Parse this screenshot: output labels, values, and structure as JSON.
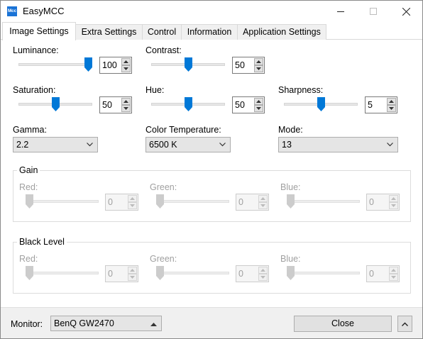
{
  "window": {
    "app_icon_text": "Mcc",
    "title": "EasyMCC"
  },
  "tabs": [
    {
      "label": "Image Settings",
      "active": true
    },
    {
      "label": "Extra Settings",
      "active": false
    },
    {
      "label": "Control",
      "active": false
    },
    {
      "label": "Information",
      "active": false
    },
    {
      "label": "Application Settings",
      "active": false
    }
  ],
  "image_settings": {
    "luminance": {
      "label": "Luminance:",
      "value": "100",
      "level_percent": 100
    },
    "contrast": {
      "label": "Contrast:",
      "value": "50",
      "level_percent": 50
    },
    "saturation": {
      "label": "Saturation:",
      "value": "50",
      "level_percent": 50
    },
    "hue": {
      "label": "Hue:",
      "value": "50",
      "level_percent": 50
    },
    "sharpness": {
      "label": "Sharpness:",
      "value": "5",
      "level_percent": 50
    },
    "gamma": {
      "label": "Gamma:",
      "value": "2.2"
    },
    "color_temperature": {
      "label": "Color Temperature:",
      "value": "6500 K"
    },
    "mode": {
      "label": "Mode:",
      "value": "13"
    },
    "gain": {
      "title": "Gain",
      "red": {
        "label": "Red:",
        "value": "0",
        "level_percent": 0
      },
      "green": {
        "label": "Green:",
        "value": "0",
        "level_percent": 0
      },
      "blue": {
        "label": "Blue:",
        "value": "0",
        "level_percent": 0
      }
    },
    "black_level": {
      "title": "Black Level",
      "red": {
        "label": "Red:",
        "value": "0",
        "level_percent": 0
      },
      "green": {
        "label": "Green:",
        "value": "0",
        "level_percent": 0
      },
      "blue": {
        "label": "Blue:",
        "value": "0",
        "level_percent": 0
      }
    }
  },
  "footer": {
    "monitor_label": "Monitor:",
    "monitor_value": "BenQ GW2470",
    "close_label": "Close"
  },
  "colors": {
    "accent": "#0078d7",
    "disabled_text": "#a0a0a0"
  }
}
